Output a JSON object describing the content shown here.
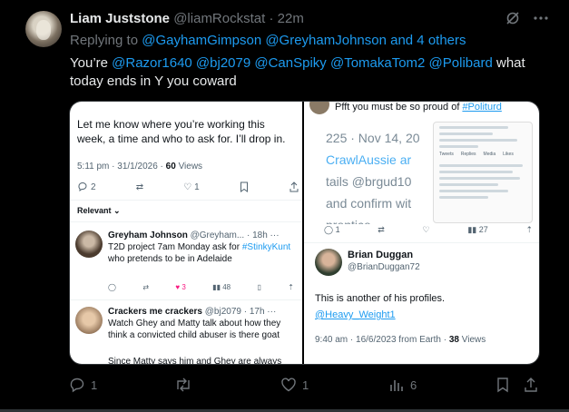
{
  "tweet": {
    "author_name": "Liam Juststone",
    "author_handle": "@liamRockstat",
    "separator": "·",
    "time": "22m",
    "replying_prefix": "Replying to",
    "replying_mentions": "@GayhamGimpson @GreyhamJohnson and 4 others",
    "text_start": "You’re",
    "text_mentions": "@Razor1640 @bj2079 @CanSpiky @TomakaTom2 @Polibard",
    "text_end": "what today ends in Y you coward",
    "stats": {
      "replies": "1",
      "retweets": "",
      "likes": "1",
      "views": "6"
    }
  },
  "left_screenshot": {
    "text": "Let me know where you’re working this week, a time and who to ask for. I’ll drop in.",
    "meta_time": "5:11 pm · 31/1/2026 ·",
    "meta_views_count": "60",
    "meta_views_label": "Views",
    "actions": {
      "replies": "2",
      "likes": "1"
    },
    "relevant_label": "Relevant ⌄",
    "reply1": {
      "name": "Greyham Johnson",
      "handle": "@Greyham... · 18h ··· ",
      "text_a": "T2D project 7am Monday ask for ",
      "text_link": "#StinkyKunt",
      "text_b": " who pretends to be in Adelaide",
      "likes": "3",
      "views": "48"
    },
    "reply2": {
      "name": "Crackers me crackers",
      "handle": "@bj2079 · 17h ···",
      "text": "Watch Ghey and Matty talk about how they think a convicted child abuser is there goat",
      "text_more": "Since Matty says him and Ghey are always"
    }
  },
  "right_screenshot": {
    "top_text_a": "Pfft you must be so proud of ",
    "top_text_link": "#Politurd",
    "blur_lines": [
      "225 · Nov 14, 20",
      "CrawlAussie ar",
      "tails @brgud10",
      "and confirm wit",
      "prentice."
    ],
    "inner_stats": {
      "replies": "1",
      "views": "27"
    },
    "phone_tabs": [
      "Tweets",
      "Replies",
      "Media",
      "Likes"
    ],
    "poster_name": "Brian Duggan",
    "poster_handle": "@BrianDuggan72",
    "post_text": "This is another of his profiles.",
    "post_link": "@Heavy_Weight1",
    "meta_time": "9:40 am · 16/6/2023 from Earth ·",
    "meta_views_count": "38",
    "meta_views_label": "Views"
  }
}
